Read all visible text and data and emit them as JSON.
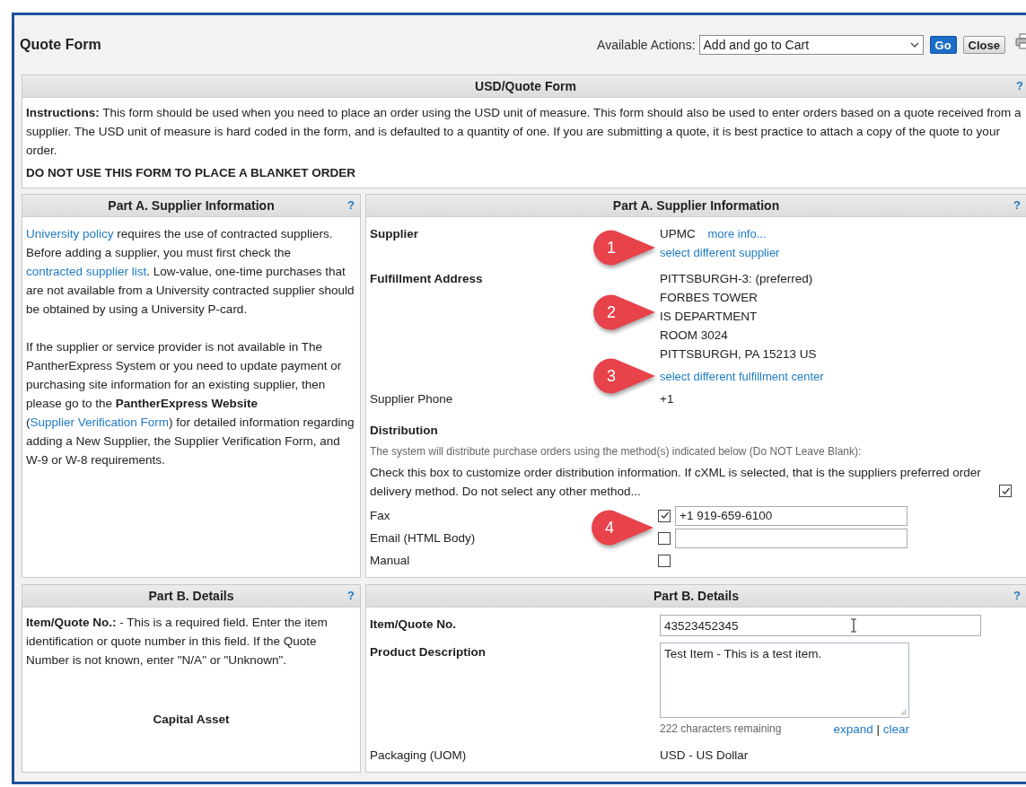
{
  "header": {
    "title": "Quote Form",
    "actions_label": "Available Actions:",
    "action": "Add and go to Cart",
    "buttons": [
      {
        "label": "Go",
        "kind": "primary"
      },
      {
        "label": "Close",
        "kind": "secondary"
      }
    ]
  },
  "form_panel": {
    "title": "USD/Quote Form",
    "help": "?",
    "instructions": "**Instructions:** This form should be used when you need to place an order using the USD unit of measure. This form should also be used to enter orders based on a quote received from a supplier. The USD unit of measure is hard coded in the form, and is defaulted to a quantity of one. If you are submitting a quote, it is best practice to attach a copy of the quote to your order.",
    "warning": "DO NOT USE THIS FORM TO PLACE A BLANKET ORDER"
  },
  "part_a": {
    "guide": {
      "title": "Part A. Supplier Information",
      "help": "?",
      "paragraphs": [
        [
          {
            "kind": "link",
            "text": "University policy"
          },
          {
            "kind": "plain",
            "text": " requires the use of contracted suppliers. Before adding a supplier, you must first check the "
          },
          {
            "kind": "link",
            "text": "contracted supplier list"
          },
          {
            "kind": "plain",
            "text": ". Low-value, one-time purchases that are not available from a University contracted supplier should be obtained by using a University P-card."
          }
        ],
        [
          {
            "kind": "plain",
            "text": "If the supplier or service provider is not available in The PantherExpress System or you need to update payment or purchasing site information for an existing supplier, then please go to the "
          },
          {
            "kind": "bold",
            "text": "PantherExpress Website"
          },
          {
            "kind": "plain",
            "text": " ("
          },
          {
            "kind": "link",
            "text": "Supplier Verification Form"
          },
          {
            "kind": "plain",
            "text": ") for detailed information regarding adding a New Supplier, the Supplier Verification Form, and W-9 or W-8 requirements."
          }
        ]
      ]
    },
    "form": {
      "title": "Part A. Supplier Information",
      "help": "?",
      "supplier": {
        "label": "Supplier",
        "name": "UPMC",
        "more_link": "more info...",
        "change_link": "select different supplier",
        "callout": "1"
      },
      "fulfillment": {
        "label": "Fulfillment Address",
        "lines": [
          "PITTSBURGH-3: (preferred)",
          "FORBES TOWER",
          "IS DEPARTMENT",
          "ROOM 3024",
          "PITTSBURGH, PA 15213 US"
        ],
        "callout": "2",
        "change_link": "select different fulfillment center",
        "change_callout": "3"
      },
      "phone": {
        "label": "Supplier Phone",
        "value": "+1"
      },
      "distribution": {
        "title": "Distribution",
        "note": "The system will distribute purchase orders using the method(s) indicated below (Do NOT Leave Blank):",
        "customize_text": "Check this box to customize order distribution information. If cXML is selected, that is the suppliers preferred order delivery method. Do not select any other method...",
        "customize_checked": true,
        "methods": [
          {
            "label": "Fax",
            "kind": "field",
            "checked": true,
            "value": "+1 919-659-6100",
            "callout": "4"
          },
          {
            "label": "Email (HTML Body)",
            "kind": "field",
            "checked": false
          },
          {
            "label": "Manual",
            "kind": "plain",
            "checked": false
          }
        ]
      }
    }
  },
  "part_b": {
    "guide": {
      "title": "Part B. Details",
      "help": "?",
      "text": "**Item/Quote No.:** - This is a required field. Enter the item identification or quote number in this field. If the Quote Number is not known, enter \"N/A\" or \"Unknown\".",
      "subheading": "Capital Asset"
    },
    "form": {
      "title": "Part B. Details",
      "help": "?",
      "item_label": "Item/Quote No.",
      "item_value": "43523452345",
      "desc_label": "Product Description",
      "desc_value": "Test Item - This is a test item.",
      "remaining": "222 characters remaining",
      "links": [
        "expand",
        "clear"
      ],
      "separator": "|",
      "packaging_label": "Packaging (UOM)",
      "packaging_value": "USD - US Dollar"
    }
  }
}
